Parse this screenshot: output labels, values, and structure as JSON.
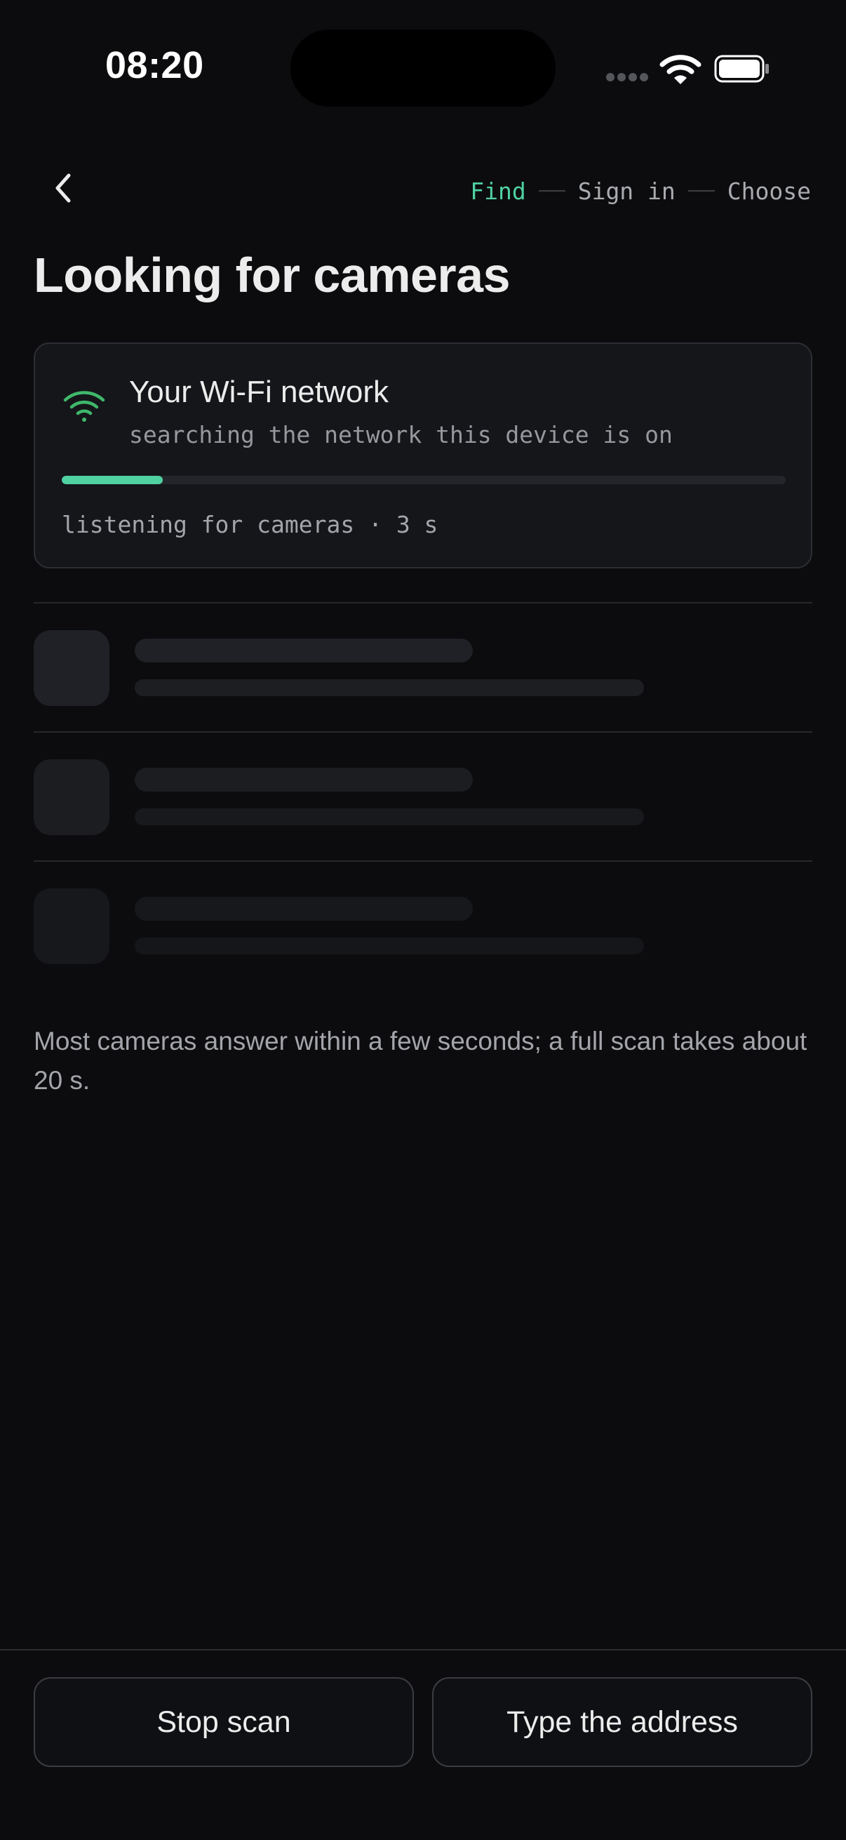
{
  "status_bar": {
    "time": "08:20"
  },
  "stepper": {
    "steps": [
      "Find",
      "Sign in",
      "Choose"
    ],
    "active_index": 0
  },
  "page": {
    "title": "Looking for cameras"
  },
  "network_card": {
    "title": "Your Wi-Fi network",
    "subtitle": "searching the network this device is on",
    "progress_fraction": 0.14,
    "status": "listening for cameras · 3 s",
    "icon": "wifi-icon"
  },
  "skeleton_rows": 3,
  "hint": "Most cameras answer within a few seconds; a full scan takes about 20 s.",
  "actions": {
    "stop_label": "Stop scan",
    "type_label": "Type the address"
  },
  "colors": {
    "accent": "#4fd1a1",
    "wifi_green": "#3fb86b",
    "background": "#0c0c0e",
    "card": "#15161a"
  }
}
